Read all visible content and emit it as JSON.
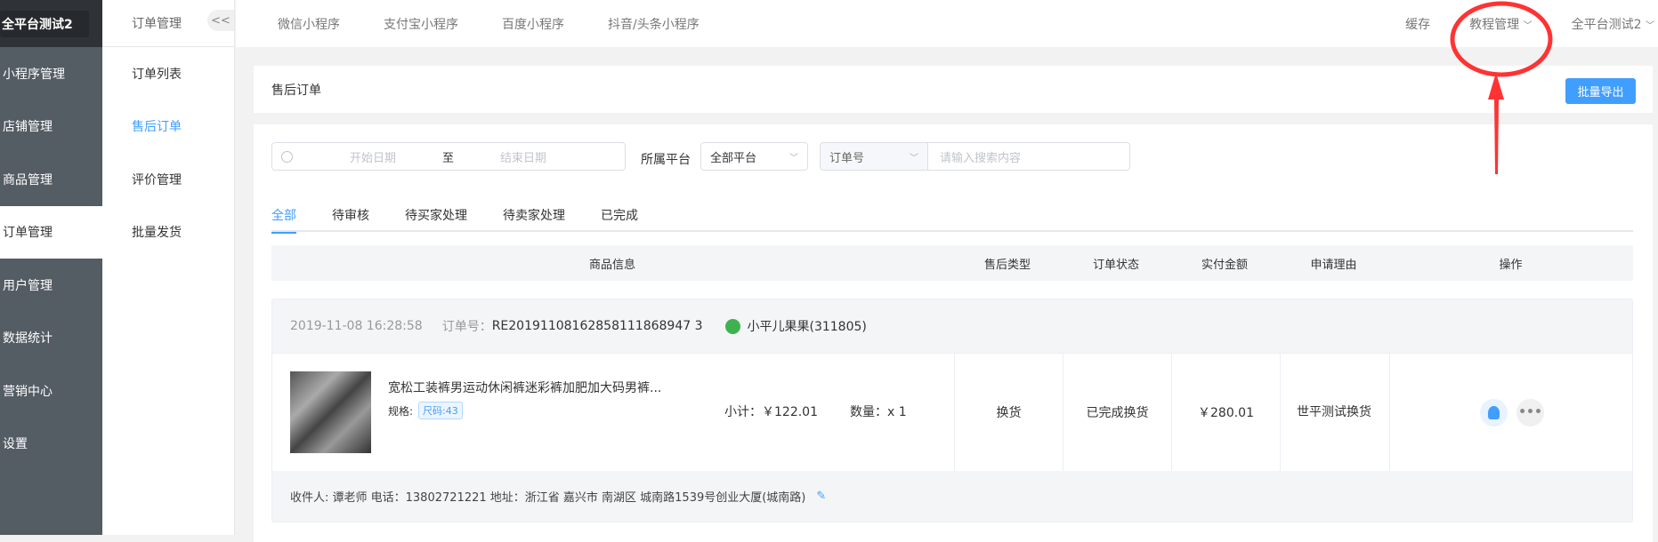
{
  "brand": "全平台测试2",
  "sidebar": [
    "小程序管理",
    "店铺管理",
    "商品管理",
    "订单管理",
    "用户管理",
    "数据统计",
    "营销中心",
    "设置"
  ],
  "subnav": {
    "title": "订单管理",
    "collapse": "<<",
    "items": [
      "订单列表",
      "售后订单",
      "评价管理",
      "批量发货"
    ]
  },
  "topbar": {
    "tabs": [
      "微信小程序",
      "支付宝小程序",
      "百度小程序",
      "抖音/头条小程序"
    ],
    "cache": "缓存",
    "tutorial": "教程管理",
    "account": "全平台测试2"
  },
  "page": {
    "title": "售后订单",
    "export": "批量导出"
  },
  "filters": {
    "start": "开始日期",
    "to": "至",
    "end": "结束日期",
    "platform_label": "所属平台",
    "platform": "全部平台",
    "field": "订单号",
    "search_placeholder": "请输入搜索内容"
  },
  "tabs": [
    "全部",
    "待审核",
    "待买家处理",
    "待卖家处理",
    "已完成"
  ],
  "columns": [
    "商品信息",
    "售后类型",
    "订单状态",
    "实付金额",
    "申请理由",
    "操作"
  ],
  "order": {
    "time": "2019-11-08 16:28:58",
    "order_no_label": "订单号：",
    "order_no": "RE20191108162858111868947 3",
    "buyer": "小平儿果果(311805)",
    "product": "宽松工装裤男运动休闲裤迷彩裤加肥加大码男裤...",
    "spec_label": "规格:",
    "spec": "尺码:43",
    "subtotal": "小计：￥122.01",
    "qty": "数量：x 1",
    "type": "换货",
    "status": "已完成换货",
    "amount": "￥280.01",
    "reason": "世平测试换货",
    "address": "收件人: 谭老师 电话：13802721221 地址：浙江省 嘉兴市 南湖区 城南路1539号创业大厦(城南路)"
  },
  "colors": {
    "accent": "#409eff",
    "annotation": "#ff3333"
  }
}
